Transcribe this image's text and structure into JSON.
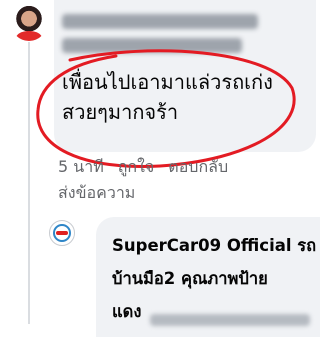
{
  "comment": {
    "text_lines": [
      "เพื่อนไปเอามาแล่วรถเก่ง",
      "สวยๆมากจร้า"
    ],
    "time": "5 นาที",
    "like_label": "ถูกใจ",
    "reply_label": "ตอบกลับ",
    "send_message_label": "ส่งข้อความ"
  },
  "reply": {
    "author_lines": [
      "SuperCar09 Official รถ",
      "บ้านมือ2 คุณภาพป้าย",
      "แดง"
    ]
  },
  "colors": {
    "bubble": "#f0f2f5",
    "annotation_circle": "#e31b23",
    "meta_text": "#65676b"
  }
}
